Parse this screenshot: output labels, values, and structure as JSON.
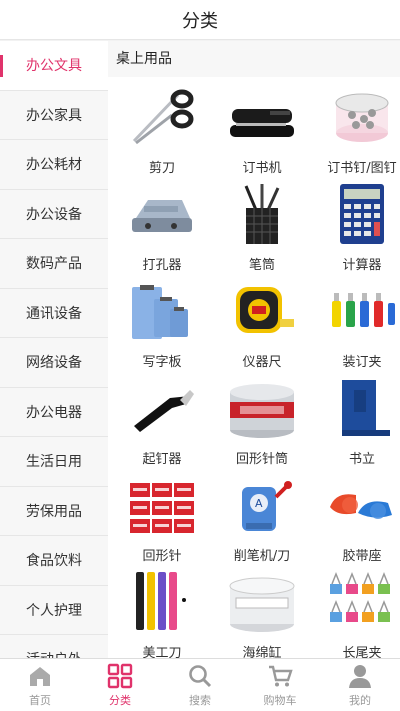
{
  "header": {
    "title": "分类"
  },
  "sidebar": {
    "items": [
      {
        "label": "办公文具",
        "active": true
      },
      {
        "label": "办公家具"
      },
      {
        "label": "办公耗材"
      },
      {
        "label": "办公设备"
      },
      {
        "label": "数码产品"
      },
      {
        "label": "通讯设备"
      },
      {
        "label": "网络设备"
      },
      {
        "label": "办公电器"
      },
      {
        "label": "生活日用"
      },
      {
        "label": "劳保用品"
      },
      {
        "label": "食品饮料"
      },
      {
        "label": "个人护理"
      },
      {
        "label": "活动户外"
      }
    ]
  },
  "content": {
    "section_title": "桌上用品",
    "products": [
      {
        "label": "剪刀",
        "icon": "scissors-icon"
      },
      {
        "label": "订书机",
        "icon": "stapler-icon"
      },
      {
        "label": "订书钉/图钉",
        "icon": "staples-icon"
      },
      {
        "label": "打孔器",
        "icon": "hole-punch-icon"
      },
      {
        "label": "笔筒",
        "icon": "pen-holder-icon"
      },
      {
        "label": "计算器",
        "icon": "calculator-icon"
      },
      {
        "label": "写字板",
        "icon": "clipboard-icon"
      },
      {
        "label": "仪器尺",
        "icon": "tape-measure-icon"
      },
      {
        "label": "装订夹",
        "icon": "binder-clip-icon"
      },
      {
        "label": "起钉器",
        "icon": "staple-remover-icon"
      },
      {
        "label": "回形针筒",
        "icon": "paperclip-tube-icon"
      },
      {
        "label": "书立",
        "icon": "bookend-icon"
      },
      {
        "label": "回形针",
        "icon": "paperclip-box-icon"
      },
      {
        "label": "削笔机/刀",
        "icon": "pencil-sharpener-icon"
      },
      {
        "label": "胶带座",
        "icon": "tape-dispenser-icon"
      },
      {
        "label": "美工刀",
        "icon": "utility-knife-icon"
      },
      {
        "label": "海绵缸",
        "icon": "sponge-jar-icon"
      },
      {
        "label": "长尾夹",
        "icon": "long-tail-clip-icon"
      }
    ]
  },
  "tabbar": {
    "tabs": [
      {
        "label": "首页",
        "icon": "home-icon"
      },
      {
        "label": "分类",
        "icon": "category-icon",
        "active": true
      },
      {
        "label": "搜索",
        "icon": "search-icon"
      },
      {
        "label": "购物车",
        "icon": "cart-icon"
      },
      {
        "label": "我的",
        "icon": "user-icon"
      }
    ]
  },
  "colors": {
    "accent": "#e0336b",
    "inactive": "#999999"
  }
}
